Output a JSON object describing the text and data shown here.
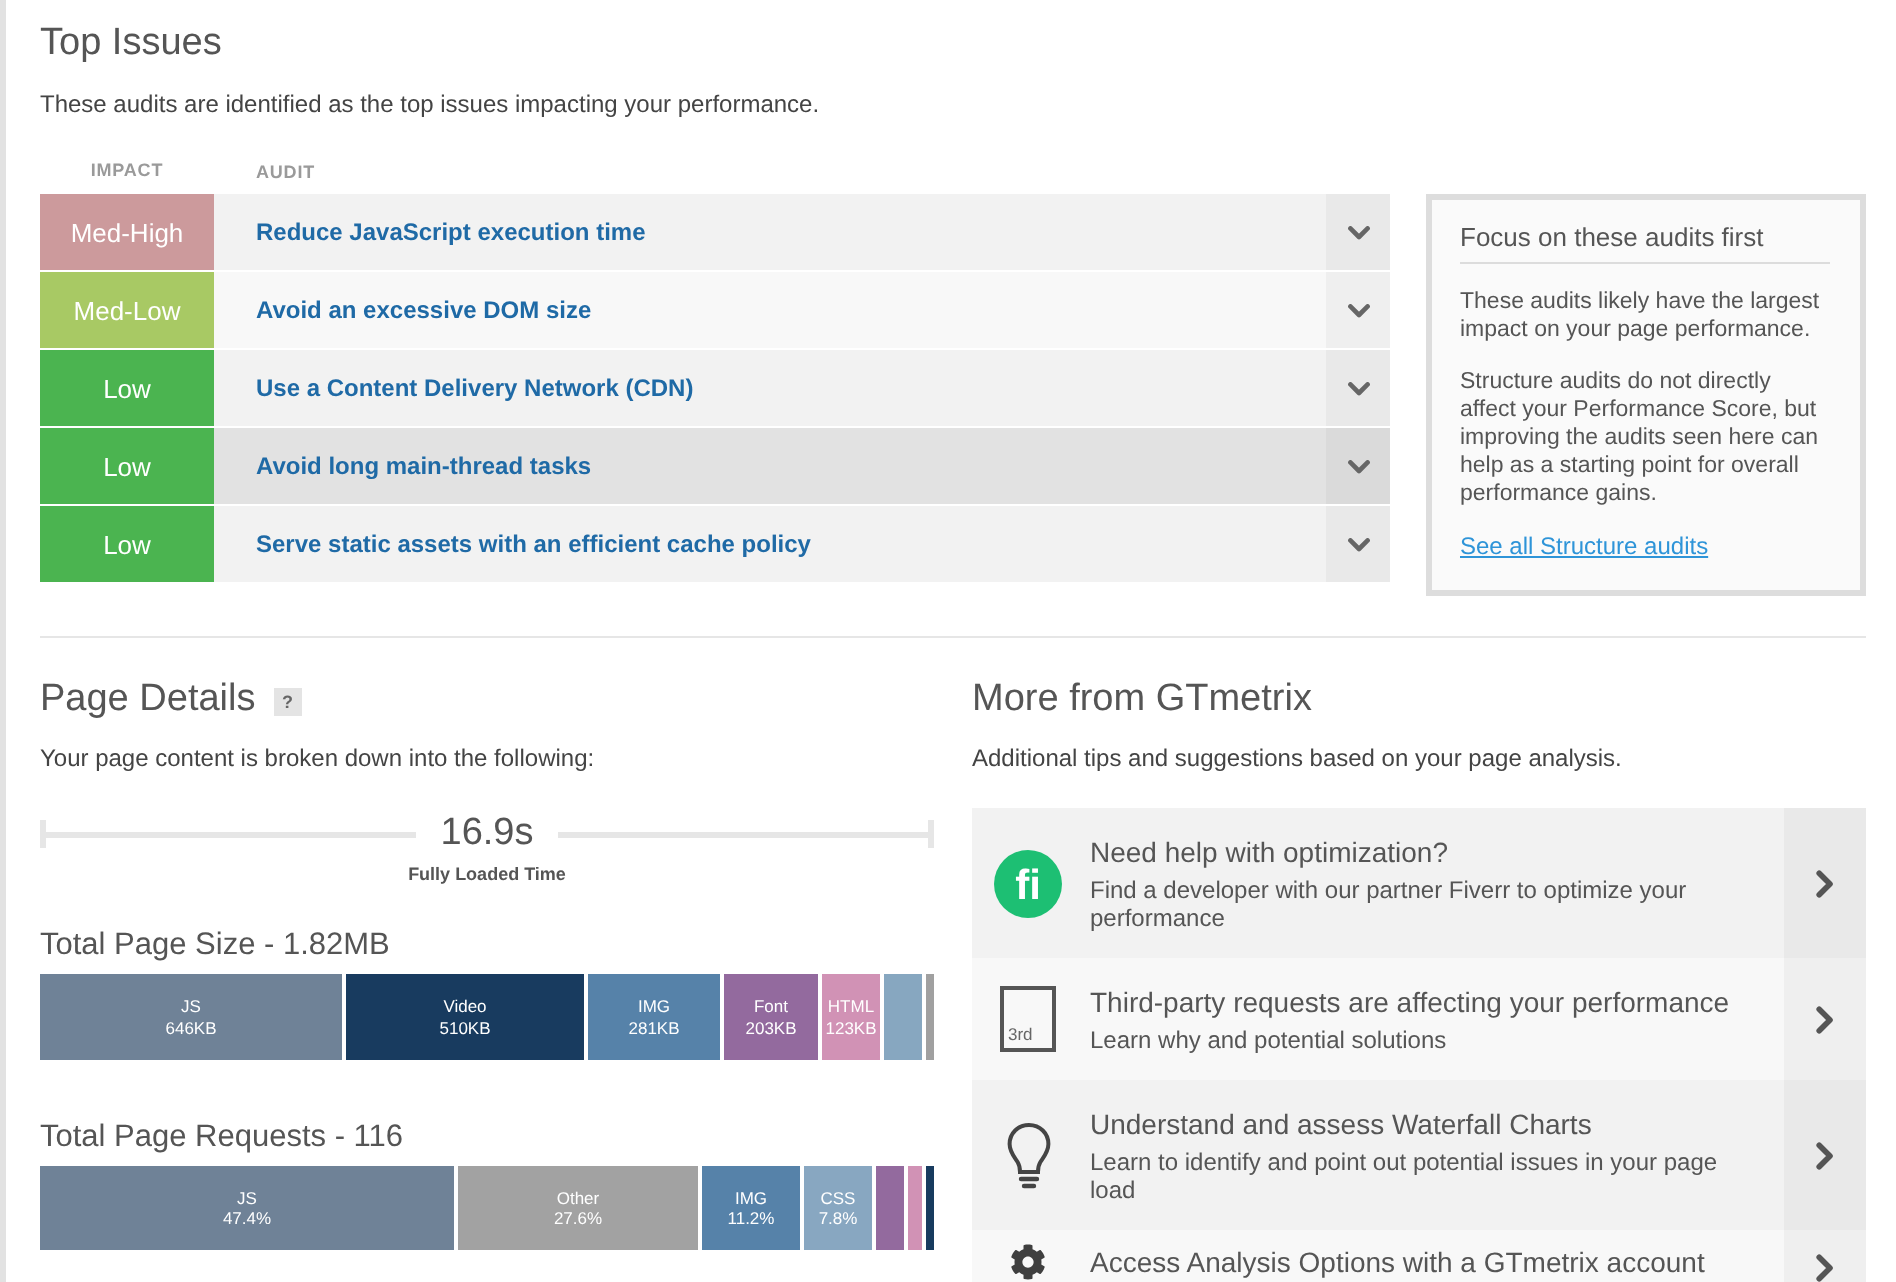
{
  "top_issues": {
    "title": "Top Issues",
    "subtitle": "These audits are identified as the top issues impacting your performance.",
    "columns": [
      "IMPACT",
      "AUDIT"
    ],
    "rows": [
      {
        "impact": "Med-High",
        "color": "#cc9a9c",
        "audit": "Reduce JavaScript execution time",
        "highlighted": false,
        "expanded": false
      },
      {
        "impact": "Med-Low",
        "color": "#a8c964",
        "audit": "Avoid an excessive DOM size",
        "highlighted": false,
        "expanded": false
      },
      {
        "impact": "Low",
        "color": "#4bb450",
        "audit": "Use a Content Delivery Network (CDN)",
        "highlighted": false,
        "expanded": false
      },
      {
        "impact": "Low",
        "color": "#4bb450",
        "audit": "Avoid long main-thread tasks",
        "highlighted": true,
        "expanded": false
      },
      {
        "impact": "Low",
        "color": "#4bb450",
        "audit": "Serve static assets with an efficient cache policy",
        "highlighted": false,
        "expanded": false
      }
    ]
  },
  "focus_panel": {
    "title": "Focus on these audits first",
    "paragraphs": [
      "These audits likely have the largest impact on your page performance.",
      "Structure audits do not directly affect your Performance Score, but improving the audits seen here can help as a starting point for overall performance gains."
    ],
    "link": "See all Structure audits"
  },
  "page_details": {
    "title": "Page Details",
    "help": "?",
    "subtitle": "Your page content is broken down into the following:",
    "timeline": {
      "value": "16.9s",
      "label": "Fully Loaded Time"
    },
    "size_bar": {
      "title": "Total Page Size - 1.82MB",
      "segments": [
        {
          "label": "JS",
          "value": "646KB",
          "color": "#6f8297"
        },
        {
          "label": "Video",
          "value": "510KB",
          "color": "#183b5f"
        },
        {
          "label": "IMG",
          "value": "281KB",
          "color": "#5682a9"
        },
        {
          "label": "Font",
          "value": "203KB",
          "color": "#936a9e"
        },
        {
          "label": "HTML",
          "value": "123KB",
          "color": "#d192b5"
        },
        {
          "color": "#87a7c0"
        },
        {
          "color": "#a0a0a0"
        }
      ]
    },
    "requests_bar": {
      "title": "Total Page Requests - 116",
      "segments": [
        {
          "label": "JS",
          "value": "47.4%",
          "color": "#6f8297"
        },
        {
          "label": "Other",
          "value": "27.6%",
          "color": "#a2a2a2"
        },
        {
          "label": "IMG",
          "value": "11.2%",
          "color": "#5682a9"
        },
        {
          "label": "CSS",
          "value": "7.8%",
          "color": "#88a7c1"
        },
        {
          "color": "#936a9e"
        },
        {
          "color": "#d192b5"
        },
        {
          "color": "#183b5f"
        }
      ]
    }
  },
  "more_from_gtmetrix": {
    "title": "More from GTmetrix",
    "subtitle": "Additional tips and suggestions based on your page analysis.",
    "cards": [
      {
        "kind": "logo",
        "icon_text": "fi",
        "title": "Need help with optimization?",
        "description": "Find a developer with our partner Fiverr to optimize your performance"
      },
      {
        "kind": "document",
        "icon_text": "3rd",
        "title": "Third-party requests are affecting your performance",
        "description": "Learn why and potential solutions"
      },
      {
        "kind": "bulb",
        "title": "Understand and assess Waterfall Charts",
        "description": "Learn to identify and point out potential issues in your page load"
      },
      {
        "kind": "gear",
        "title": "Access Analysis Options with a GTmetrix account"
      }
    ]
  }
}
